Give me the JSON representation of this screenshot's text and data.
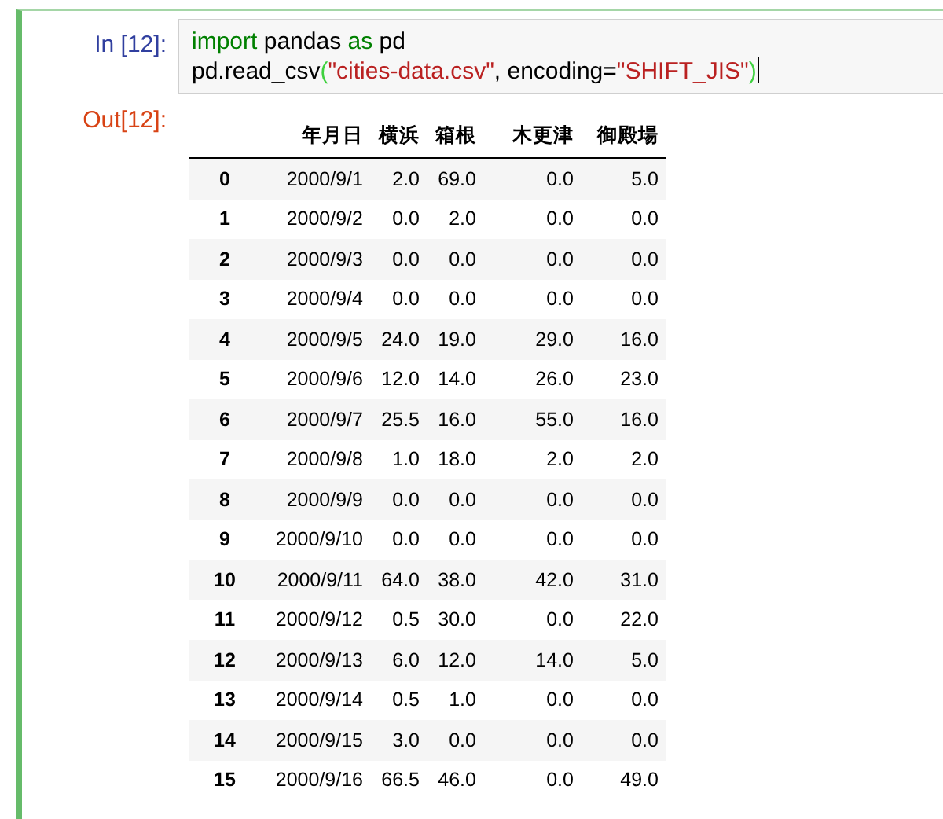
{
  "input_prompt": "In [12]:",
  "code_lines": [
    [
      {
        "kind": "keyword",
        "text": "import"
      },
      {
        "kind": "plain",
        "text": " pandas "
      },
      {
        "kind": "keyword",
        "text": "as"
      },
      {
        "kind": "plain",
        "text": " pd"
      }
    ],
    [
      {
        "kind": "plain",
        "text": "pd.read_csv"
      },
      {
        "kind": "bracket",
        "text": "("
      },
      {
        "kind": "string",
        "text": "\"cities-data.csv\""
      },
      {
        "kind": "plain",
        "text": ", encoding="
      },
      {
        "kind": "string",
        "text": "\"SHIFT_JIS\""
      },
      {
        "kind": "bracket",
        "text": ")"
      }
    ]
  ],
  "output_prompt": "Out[12]:",
  "table": {
    "columns": [
      "年月日",
      "横浜",
      "箱根",
      "木更津",
      "御殿場"
    ],
    "rows": [
      {
        "index": "0",
        "cells": [
          "2000/9/1",
          "2.0",
          "69.0",
          "0.0",
          "5.0"
        ]
      },
      {
        "index": "1",
        "cells": [
          "2000/9/2",
          "0.0",
          "2.0",
          "0.0",
          "0.0"
        ]
      },
      {
        "index": "2",
        "cells": [
          "2000/9/3",
          "0.0",
          "0.0",
          "0.0",
          "0.0"
        ]
      },
      {
        "index": "3",
        "cells": [
          "2000/9/4",
          "0.0",
          "0.0",
          "0.0",
          "0.0"
        ]
      },
      {
        "index": "4",
        "cells": [
          "2000/9/5",
          "24.0",
          "19.0",
          "29.0",
          "16.0"
        ]
      },
      {
        "index": "5",
        "cells": [
          "2000/9/6",
          "12.0",
          "14.0",
          "26.0",
          "23.0"
        ]
      },
      {
        "index": "6",
        "cells": [
          "2000/9/7",
          "25.5",
          "16.0",
          "55.0",
          "16.0"
        ]
      },
      {
        "index": "7",
        "cells": [
          "2000/9/8",
          "1.0",
          "18.0",
          "2.0",
          "2.0"
        ]
      },
      {
        "index": "8",
        "cells": [
          "2000/9/9",
          "0.0",
          "0.0",
          "0.0",
          "0.0"
        ]
      },
      {
        "index": "9",
        "cells": [
          "2000/9/10",
          "0.0",
          "0.0",
          "0.0",
          "0.0"
        ]
      },
      {
        "index": "10",
        "cells": [
          "2000/9/11",
          "64.0",
          "38.0",
          "42.0",
          "31.0"
        ]
      },
      {
        "index": "11",
        "cells": [
          "2000/9/12",
          "0.5",
          "30.0",
          "0.0",
          "22.0"
        ]
      },
      {
        "index": "12",
        "cells": [
          "2000/9/13",
          "6.0",
          "12.0",
          "14.0",
          "5.0"
        ]
      },
      {
        "index": "13",
        "cells": [
          "2000/9/14",
          "0.5",
          "1.0",
          "0.0",
          "0.0"
        ]
      },
      {
        "index": "14",
        "cells": [
          "2000/9/15",
          "3.0",
          "0.0",
          "0.0",
          "0.0"
        ]
      },
      {
        "index": "15",
        "cells": [
          "2000/9/16",
          "66.5",
          "46.0",
          "0.0",
          "49.0"
        ]
      }
    ]
  }
}
